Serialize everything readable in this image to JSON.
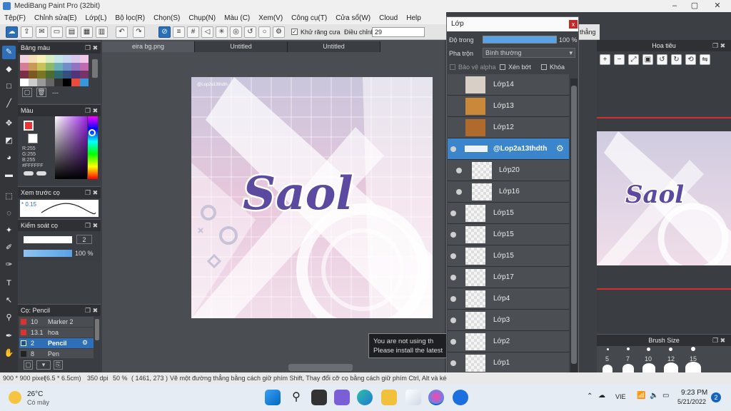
{
  "window": {
    "title": "MediBang Paint Pro (32bit)"
  },
  "menu": [
    "Tệp(F)",
    "Chỉnh sửa(E)",
    "Lớp(L)",
    "Bộ lọc(R)",
    "Chọn(S)",
    "Chụp(N)",
    "Màu (C)",
    "Xem(V)",
    "Công cụ(T)",
    "Cửa sổ(W)",
    "Cloud",
    "Help"
  ],
  "toolbar": {
    "antialias_label": "Khử răng cưa",
    "adjust_label": "Điều chỉnh",
    "adjust_value": "29",
    "extra_label": "thẳng"
  },
  "tabs": [
    "eira bg.png",
    "Untitled",
    "Untitled"
  ],
  "palette_panel": {
    "title": "Bảng màu",
    "footer": "---"
  },
  "color_panel": {
    "title": "Màu",
    "r": "R:255",
    "g": "G:255",
    "b": "B:255",
    "hex": "#FFFFFF"
  },
  "brush_preview": {
    "title": "Xem trước cọ",
    "size": "0.15"
  },
  "brush_control": {
    "title": "Kiểm soát cọ",
    "size_value": "2",
    "opacity_value": "100 %"
  },
  "brush_list": {
    "title": "Cọ: Pencil",
    "items": [
      {
        "size": "10",
        "name": "Marker 2",
        "color": "#e03030"
      },
      {
        "size": "13.1",
        "name": "hoa",
        "color": "#e03030"
      },
      {
        "size": "2",
        "name": "Pencil",
        "color": "#2a6fb8"
      },
      {
        "size": "8",
        "name": "Pen",
        "color": "#222222"
      }
    ]
  },
  "layer_panel": {
    "title": "Lớp",
    "opacity_label": "Độ trong",
    "opacity_value": "100 %",
    "blend_label": "Pha trộn",
    "blend_value": "Bình thường",
    "protect_alpha": "Bảo vệ alpha",
    "clipping": "Xén bớt",
    "lock": "Khóa",
    "layers": [
      "Lớp14",
      "Lớp13",
      "Lớp12",
      "@Lop2a13thdth",
      "Lớp20",
      "Lớp16",
      "Lớp15",
      "Lớp15",
      "Lớp15",
      "Lớp17",
      "Lớp4",
      "Lớp3",
      "Lớp2",
      "Lớp1"
    ]
  },
  "navigator": {
    "title": "Hoa tiêu"
  },
  "brush_size": {
    "title": "Brush Size",
    "sizes": [
      "5",
      "7",
      "10",
      "12",
      "15"
    ]
  },
  "artwork": {
    "text": "Saol",
    "watermark": "@Lop2a13thdth"
  },
  "notice": {
    "line1": "You are not using th",
    "line2": "Please install the latest"
  },
  "status": {
    "size": "900 * 900 pixel",
    "cm": "(6.5 * 6.5cm)",
    "dpi": "350 dpi",
    "zoom": "50 %",
    "coords": "( 1461, 273 )",
    "hint": "Vẽ một đường thẳng bằng cách giữ phím Shift, Thay đổi cỡ cọ bằng cách giữ phím Ctrl, Alt và kéo"
  },
  "taskbar": {
    "temp": "26°C",
    "weather": "Có mây",
    "lang": "VIE",
    "time": "9:23 PM",
    "date": "5/21/2022",
    "badge": "2"
  },
  "colors": {
    "accent": "#2f6fb8",
    "panel": "#3a3d42",
    "layer_selected": "#3a85cc"
  }
}
